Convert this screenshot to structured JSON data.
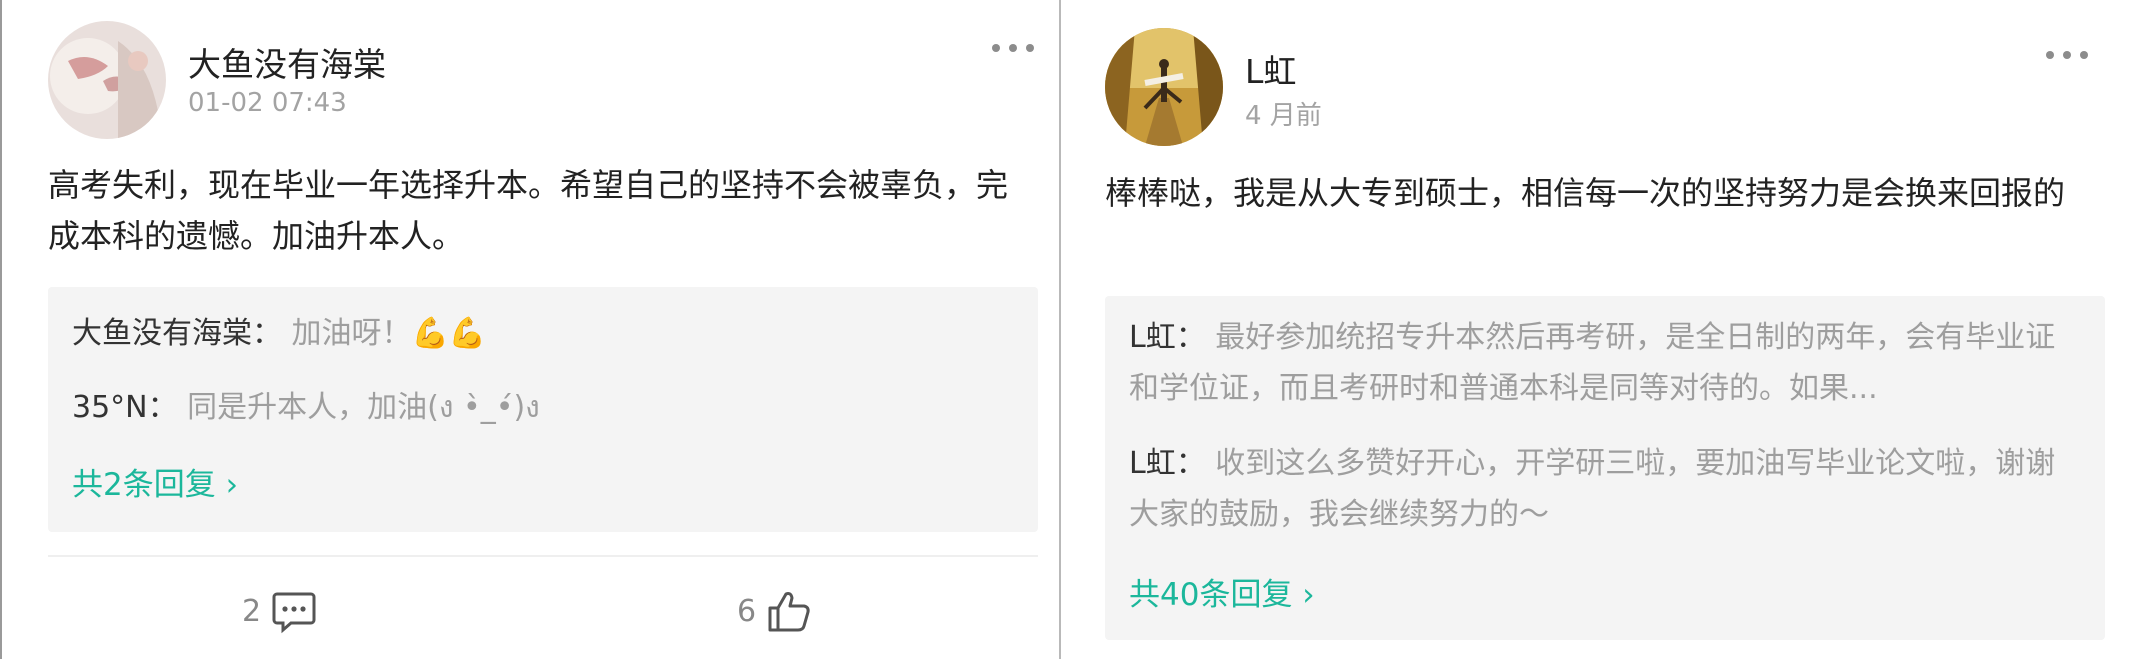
{
  "left_post": {
    "author": "大鱼没有海棠",
    "time": "01-02 07:43",
    "content": "高考失利，现在毕业一年选择升本。希望自己的坚持不会被辜负，完成本科的遗憾。加油升本人。",
    "replies": [
      {
        "author": "大鱼没有海棠",
        "separator": "：",
        "text": "加油呀！💪💪"
      },
      {
        "author": "35°N",
        "separator": "：",
        "text": "同是升本人，加油(ง •̀_•́)ง"
      }
    ],
    "more_replies_label": "共2条回复 ›",
    "comment_count": "2",
    "like_count": "6",
    "icons": {
      "more": "more-dots-icon",
      "comment": "comment-icon",
      "like": "thumbs-up-icon"
    }
  },
  "right_post": {
    "author": "L虹",
    "time": "4 月前",
    "content": "棒棒哒，我是从大专到硕士，相信每一次的坚持努力是会换来回报的",
    "replies": [
      {
        "author": "L虹",
        "separator": "：",
        "text": "最好参加统招专升本然后再考研，是全日制的两年，会有毕业证和学位证，而且考研时和普通本科是同等对待的。如果..."
      },
      {
        "author": "L虹",
        "separator": "：",
        "text": "收到这么多赞好开心，开学研三啦，要加油写毕业论文啦，谢谢大家的鼓励，我会继续努力的～"
      }
    ],
    "more_replies_label": "共40条回复 ›",
    "icons": {
      "more": "more-dots-icon"
    }
  },
  "colors": {
    "accent": "#1bb79b",
    "muted_text": "#9e9e9e",
    "reply_bg": "#f4f4f4"
  }
}
